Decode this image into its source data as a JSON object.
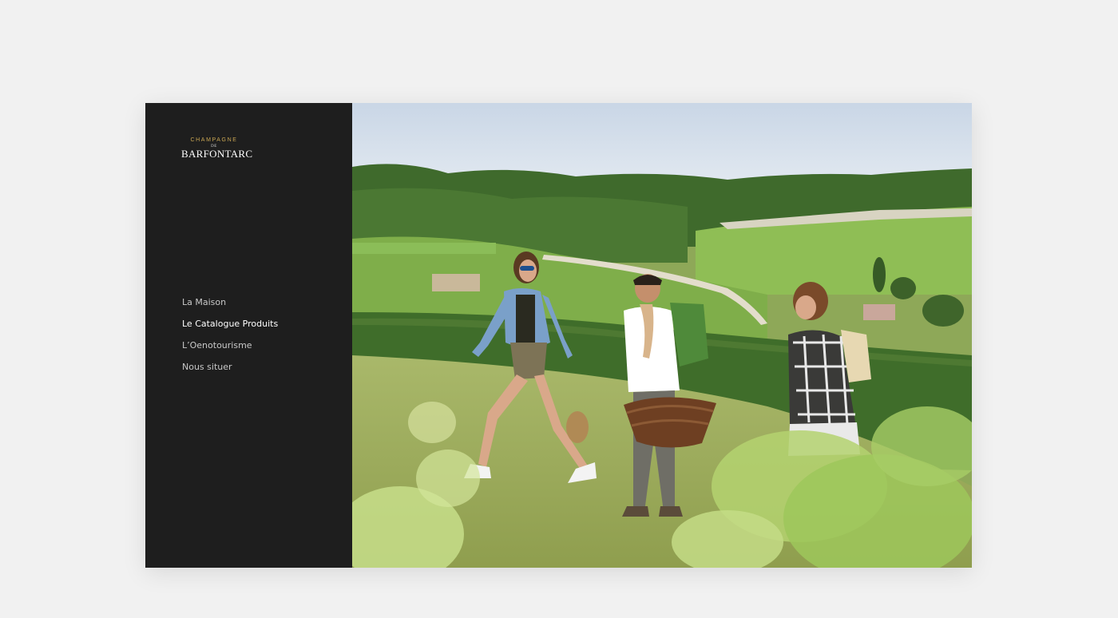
{
  "brand": {
    "line1": "CHAMPAGNE",
    "line2": "DE",
    "name": "BARFONTARC"
  },
  "nav": {
    "items": [
      {
        "label": "La Maison"
      },
      {
        "label": "Le Catalogue Produits"
      },
      {
        "label": "L’Oenotourisme"
      },
      {
        "label": "Nous situer"
      }
    ]
  },
  "colors": {
    "sidebar_bg": "#1e1e1e",
    "page_bg": "#f1f1f1",
    "brand_gold": "#c9a653"
  },
  "hero": {
    "image": "vineyard-walkers-photo"
  }
}
